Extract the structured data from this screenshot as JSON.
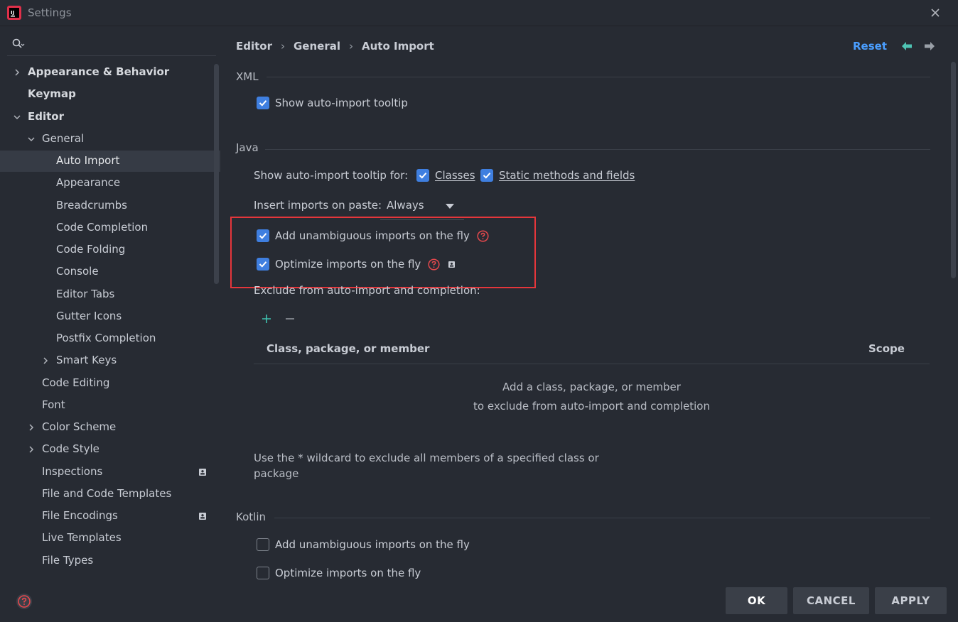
{
  "window": {
    "title": "Settings"
  },
  "search": {
    "placeholder": ""
  },
  "sidebar": {
    "items": [
      {
        "label": "Appearance & Behavior",
        "bold": true,
        "chevron": "right",
        "indent": 0
      },
      {
        "label": "Keymap",
        "bold": true,
        "chevron": "",
        "indent": 0
      },
      {
        "label": "Editor",
        "bold": true,
        "chevron": "down",
        "indent": 0
      },
      {
        "label": "General",
        "bold": false,
        "chevron": "down",
        "indent": 1
      },
      {
        "label": "Auto Import",
        "bold": false,
        "chevron": "",
        "indent": 2,
        "selected": true
      },
      {
        "label": "Appearance",
        "bold": false,
        "chevron": "",
        "indent": 2
      },
      {
        "label": "Breadcrumbs",
        "bold": false,
        "chevron": "",
        "indent": 2
      },
      {
        "label": "Code Completion",
        "bold": false,
        "chevron": "",
        "indent": 2
      },
      {
        "label": "Code Folding",
        "bold": false,
        "chevron": "",
        "indent": 2
      },
      {
        "label": "Console",
        "bold": false,
        "chevron": "",
        "indent": 2
      },
      {
        "label": "Editor Tabs",
        "bold": false,
        "chevron": "",
        "indent": 2
      },
      {
        "label": "Gutter Icons",
        "bold": false,
        "chevron": "",
        "indent": 2
      },
      {
        "label": "Postfix Completion",
        "bold": false,
        "chevron": "",
        "indent": 2
      },
      {
        "label": "Smart Keys",
        "bold": false,
        "chevron": "right",
        "indent": 2
      },
      {
        "label": "Code Editing",
        "bold": false,
        "chevron": "",
        "indent": 1
      },
      {
        "label": "Font",
        "bold": false,
        "chevron": "",
        "indent": 1
      },
      {
        "label": "Color Scheme",
        "bold": false,
        "chevron": "right",
        "indent": 1
      },
      {
        "label": "Code Style",
        "bold": false,
        "chevron": "right",
        "indent": 1
      },
      {
        "label": "Inspections",
        "bold": false,
        "chevron": "",
        "indent": 1,
        "badge": true
      },
      {
        "label": "File and Code Templates",
        "bold": false,
        "chevron": "",
        "indent": 1
      },
      {
        "label": "File Encodings",
        "bold": false,
        "chevron": "",
        "indent": 1,
        "badge": true
      },
      {
        "label": "Live Templates",
        "bold": false,
        "chevron": "",
        "indent": 1
      },
      {
        "label": "File Types",
        "bold": false,
        "chevron": "",
        "indent": 1
      }
    ]
  },
  "breadcrumb": {
    "items": [
      "Editor",
      "General",
      "Auto Import"
    ]
  },
  "header": {
    "reset_label": "Reset"
  },
  "xml": {
    "title": "XML",
    "show_tooltip": {
      "label": "Show auto-import tooltip",
      "checked": true
    }
  },
  "java": {
    "title": "Java",
    "tooltip_for_label": "Show auto-import tooltip for:",
    "classes": {
      "label": "Classes",
      "checked": true
    },
    "static_methods": {
      "label": "Static methods and fields",
      "checked": true
    },
    "insert_on_paste_label": "Insert imports on paste:",
    "insert_on_paste_value": "Always",
    "add_unambiguous": {
      "label": "Add unambiguous imports on the fly",
      "checked": true
    },
    "optimize": {
      "label": "Optimize imports on the fly",
      "checked": true
    },
    "exclude_label": "Exclude from auto-import and completion:",
    "table": {
      "col_member": "Class, package, or member",
      "col_scope": "Scope",
      "empty_line1": "Add a class, package, or member",
      "empty_line2": "to exclude from auto-import and completion"
    },
    "wildcard_note": "Use the * wildcard to exclude all members of a specified class or package"
  },
  "kotlin": {
    "title": "Kotlin",
    "add_unambiguous": {
      "label": "Add unambiguous imports on the fly",
      "checked": false
    },
    "optimize": {
      "label": "Optimize imports on the fly",
      "checked": false
    }
  },
  "footer": {
    "ok_label": "OK",
    "cancel_label": "CANCEL",
    "apply_label": "APPLY"
  },
  "colors": {
    "accent": "#3f7fe0",
    "link": "#4a9eff",
    "highlight": "#e5363b",
    "background": "#272b33"
  }
}
